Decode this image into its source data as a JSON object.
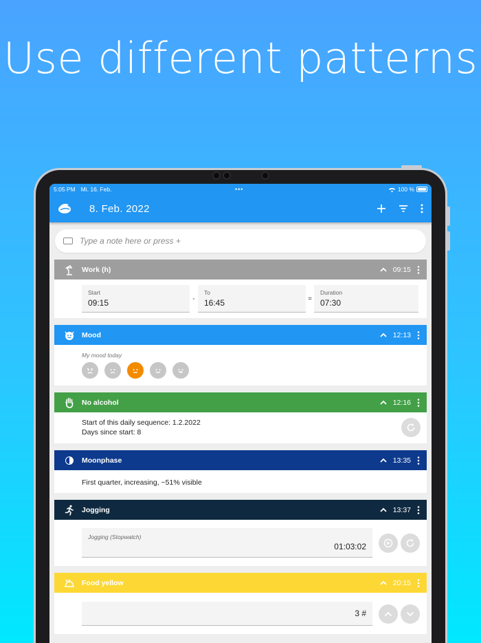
{
  "headline": "Use different patterns",
  "status": {
    "time": "5:05 PM",
    "date": "Mi. 16. Feb.",
    "battery": "100 %"
  },
  "appbar": {
    "date": "8. Feb. 2022"
  },
  "note_input": {
    "placeholder": "Type a note here or press +"
  },
  "cards": [
    {
      "title": "Work (h)",
      "time": "09:15",
      "color": "#9e9e9e",
      "start_label": "Start",
      "start_value": "09:15",
      "to_label": "To",
      "to_value": "16:45",
      "duration_label": "Duration",
      "duration_value": "07:30",
      "sep1": "-",
      "sep2": "="
    },
    {
      "title": "Mood",
      "time": "12:13",
      "color": "#2196f3",
      "prompt": "My mood today",
      "selected_index": 2
    },
    {
      "title": "No alcohol",
      "time": "12:16",
      "color": "#43a047",
      "line1": "Start of this daily sequence: 1.2.2022",
      "line2": "Days since start: 8"
    },
    {
      "title": "Moonphase",
      "time": "13:35",
      "color": "#0d3a8c",
      "text": "First quarter, increasing, ~51% visible"
    },
    {
      "title": "Jogging",
      "time": "13:37",
      "color": "#0f2a40",
      "field_label": "Jogging (Stopwatch)",
      "field_value": "01:03:02"
    },
    {
      "title": "Food yellow",
      "time": "20:15",
      "color": "#fdd835",
      "field_value": "3 #"
    }
  ]
}
